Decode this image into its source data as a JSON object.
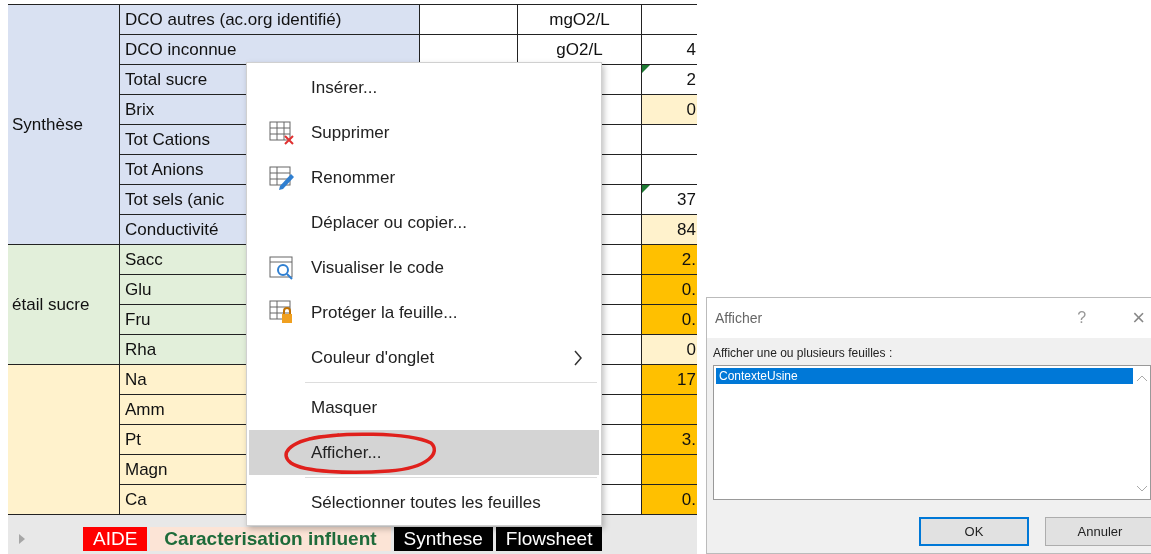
{
  "sheet": {
    "groups": [
      {
        "label": "Synthèse",
        "color": "#d9e1f2",
        "rows": [
          {
            "name": "DCO autres (ac.org identifié)",
            "unit": "mgO2/L",
            "value": ""
          },
          {
            "name": "DCO inconnue",
            "unit": "gO2/L",
            "value": "4"
          },
          {
            "name": "Total sucre",
            "value": "2",
            "comment": true
          },
          {
            "name": "Brix",
            "value": "0",
            "color": "#fff2cc"
          },
          {
            "name": "Tot Cations",
            "value": ""
          },
          {
            "name": "Tot Anions",
            "value": ""
          },
          {
            "name": "Tot sels (anic",
            "value": "37",
            "comment": true
          },
          {
            "name": "Conductivité",
            "value": "84",
            "color": "#fff2cc"
          }
        ]
      },
      {
        "label": "étail sucre",
        "color": "#e2efda",
        "rows": [
          {
            "name": "Sacc",
            "value": "2.",
            "color": "#ffc000"
          },
          {
            "name": "Glu",
            "value": "0.",
            "color": "#ffc000"
          },
          {
            "name": "Fru",
            "value": "0.",
            "color": "#ffc000"
          },
          {
            "name": "Rha",
            "value": "0",
            "color": "#fff2cc"
          }
        ]
      },
      {
        "color": "#fff2cc",
        "rows": [
          {
            "name": "Na",
            "value": "17",
            "color": "#ffc000"
          },
          {
            "name": "Amm",
            "value": "",
            "color": "#ffc000"
          },
          {
            "name": "Pt",
            "value": "3.",
            "color": "#ffc000"
          },
          {
            "name": "Magn",
            "value": "",
            "color": "#ffc000"
          },
          {
            "name": "Ca",
            "value": "0.",
            "color": "#ffc000"
          }
        ]
      }
    ]
  },
  "sheet_tabs": [
    {
      "label": "AIDE",
      "color": "#ff0000",
      "selected": false
    },
    {
      "label": "Caracterisation influent",
      "color": "#fce4d6",
      "selected": true
    },
    {
      "label": "Synthese",
      "color": "#000000",
      "selected": false
    },
    {
      "label": "Flowsheet",
      "color": "#000000",
      "selected": false
    }
  ],
  "context_menu": {
    "items": [
      {
        "kind": "item",
        "label": "Insérer..."
      },
      {
        "kind": "delete",
        "label": "Supprimer"
      },
      {
        "kind": "rename",
        "label": "Renommer"
      },
      {
        "kind": "item",
        "label": "Déplacer ou copier..."
      },
      {
        "kind": "code",
        "label": "Visualiser le code"
      },
      {
        "kind": "protect",
        "label": "Protéger la feuille..."
      },
      {
        "kind": "item",
        "label": "Couleur d'onglet",
        "submenu": true
      },
      {
        "kind": "separator"
      },
      {
        "kind": "item",
        "label": "Masquer"
      },
      {
        "kind": "item",
        "label": "Afficher...",
        "highlighted": true,
        "circled": true
      },
      {
        "kind": "separator"
      },
      {
        "kind": "item",
        "label": "Sélectionner toutes les feuilles"
      }
    ]
  },
  "dialog": {
    "title": "Afficher",
    "help": "?",
    "close": "×",
    "label": "Afficher une ou plusieurs feuilles :",
    "list": [
      {
        "label": "ContexteUsine",
        "selected": true
      }
    ],
    "buttons": [
      {
        "label": "OK",
        "default": true
      },
      {
        "label": "Annuler",
        "default": false
      }
    ]
  }
}
